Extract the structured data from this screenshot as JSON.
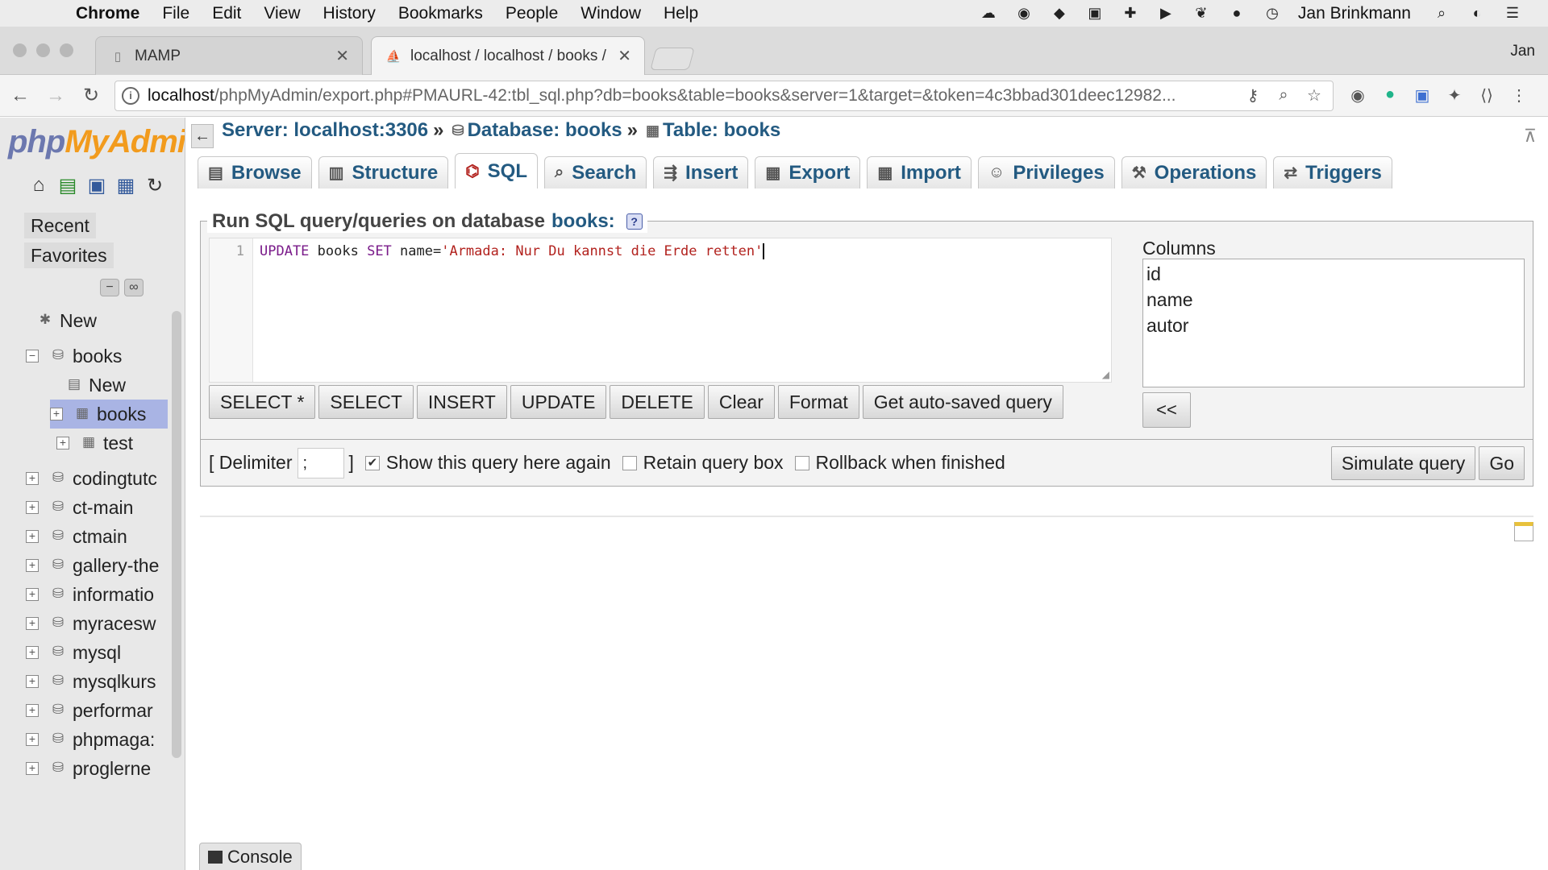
{
  "menubar": {
    "apple": "",
    "items": [
      "Chrome",
      "File",
      "Edit",
      "View",
      "History",
      "Bookmarks",
      "People",
      "Window",
      "Help"
    ],
    "user": "Jan Brinkmann"
  },
  "browser": {
    "tabs": [
      {
        "title": "MAMP"
      },
      {
        "title": "localhost / localhost / books / l"
      }
    ],
    "profile": "Jan",
    "url_host": "localhost",
    "url_path": "/phpMyAdmin/export.php#PMAURL-42:tbl_sql.php?db=books&table=books&server=1&target=&token=4c3bbad301deec12982..."
  },
  "nav": {
    "logo_php": "php",
    "logo_my": "MyAdmi",
    "recent": "Recent",
    "favorites": "Favorites",
    "tree": [
      {
        "label": "New",
        "level": 1
      },
      {
        "label": "books",
        "level": 0
      },
      {
        "label": "New",
        "level": 2
      },
      {
        "label": "books",
        "level": 1
      },
      {
        "label": "test",
        "level": 1
      },
      {
        "label": "codingtutc",
        "level": 0
      },
      {
        "label": "ct-main",
        "level": 0
      },
      {
        "label": "ctmain",
        "level": 0
      },
      {
        "label": "gallery-the",
        "level": 0
      },
      {
        "label": "informatio",
        "level": 0
      },
      {
        "label": "myracesw",
        "level": 0
      },
      {
        "label": "mysql",
        "level": 0
      },
      {
        "label": "mysqlkurs",
        "level": 0
      },
      {
        "label": "performar",
        "level": 0
      },
      {
        "label": "phpmaga:",
        "level": 0
      },
      {
        "label": "proglerne",
        "level": 0
      }
    ]
  },
  "breadcrumb": {
    "server": "Server: localhost:3306",
    "database": "Database: books",
    "table": "Table: books",
    "sep": "»"
  },
  "tabs": [
    "Browse",
    "Structure",
    "SQL",
    "Search",
    "Insert",
    "Export",
    "Import",
    "Privileges",
    "Operations",
    "Triggers"
  ],
  "sql": {
    "legend_prefix": "Run SQL query/queries on database",
    "legend_db": "books:",
    "line_number": "1",
    "query_kw1": "UPDATE",
    "query_id1": " books ",
    "query_kw2": "SET",
    "query_id2": " name=",
    "query_str": "'Armada: Nur Du kannst die Erde retten'",
    "buttons": [
      "SELECT *",
      "SELECT",
      "INSERT",
      "UPDATE",
      "DELETE",
      "Clear",
      "Format",
      "Get auto-saved query"
    ],
    "columns_label": "Columns",
    "columns": [
      "id",
      "name",
      "autor"
    ],
    "insert_column_btn": "<<"
  },
  "options": {
    "delimiter_open": "[ Delimiter",
    "delimiter_value": ";",
    "delimiter_close": "]",
    "show_query_again": "Show this query here again",
    "show_query_again_checked": true,
    "retain_query_box": "Retain query box",
    "rollback": "Rollback when finished",
    "simulate": "Simulate query",
    "go": "Go"
  },
  "console": "Console"
}
